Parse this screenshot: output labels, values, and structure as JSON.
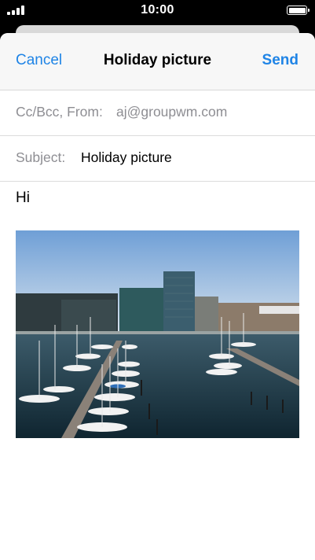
{
  "status_bar": {
    "time": "10:00",
    "signal_icon": "cellular-signal-icon",
    "battery_icon": "battery-icon"
  },
  "compose": {
    "cancel_label": "Cancel",
    "title": "Holiday picture",
    "send_label": "Send",
    "cc_bcc_from_label": "Cc/Bcc, From:",
    "from_value": "aj@groupwm.com",
    "subject_label": "Subject:",
    "subject_value": "Holiday picture",
    "body_text": "Hi",
    "attachment": "photo of a marina with sailboats and office buildings"
  },
  "colors": {
    "accent": "#1f84e6",
    "secondary_text": "#8e8e93",
    "nav_background": "#f7f7f7"
  }
}
